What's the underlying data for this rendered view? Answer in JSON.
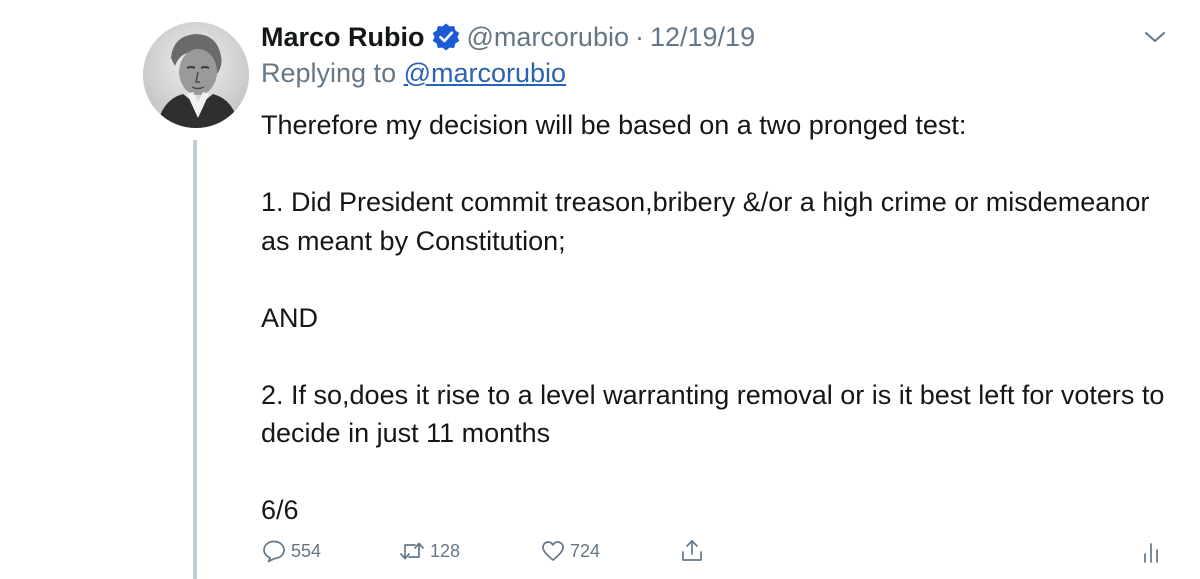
{
  "tweet": {
    "author_name": "Marco Rubio",
    "handle": "@marcorubio",
    "separator": "·",
    "date": "12/19/19",
    "replying_prefix": "Replying to",
    "replying_handle": "@marcorubio",
    "paragraphs": [
      "Therefore my decision will be based on a two pronged test:",
      "1. Did President commit treason,bribery &/or a high crime or misdemeanor as meant by Constitution;",
      "AND",
      "2. If so,does it rise to a level warranting removal or is it best left for voters to decide in just 11 months",
      "6/6"
    ]
  },
  "actions": {
    "replies": "554",
    "retweets": "128",
    "likes": "724"
  },
  "icons": {
    "avatar": "portrait-engraving-avatar",
    "verified": "verified-badge-icon",
    "menu": "chevron-down-icon",
    "reply": "reply-icon",
    "retweet": "retweet-icon",
    "like": "heart-icon",
    "share": "share-icon",
    "stats": "analytics-icon"
  },
  "colors": {
    "text": "#14171a",
    "secondary": "#657786",
    "link": "#2c62b3",
    "verified": "#1d5bd6",
    "thread_line": "#c4ccd3"
  }
}
